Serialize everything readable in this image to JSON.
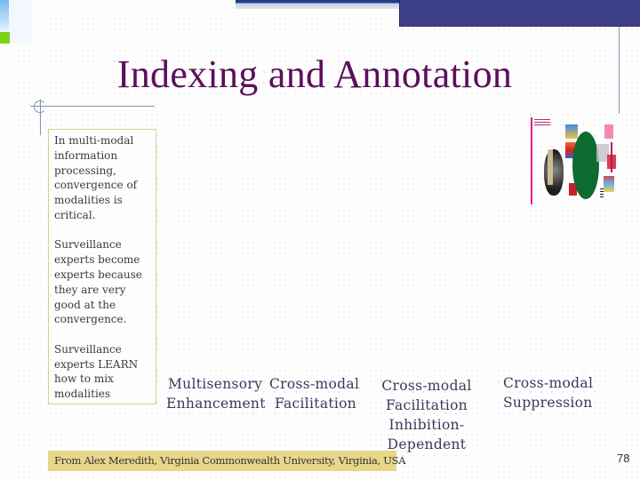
{
  "slide": {
    "title": "Indexing and Annotation",
    "sidebar_paragraphs": [
      "In multi-modal information processing, convergence of modalities is critical.",
      "Surveillance experts become experts because they are very good at the convergence.",
      "Surveillance experts LEARN how to mix modalities"
    ],
    "figure_caption_icon": "brain-multisensory-diagram",
    "labels": [
      {
        "lines": [
          "Multisensory",
          "Enhancement"
        ]
      },
      {
        "lines": [
          "Cross-modal",
          "Facilitation"
        ]
      },
      {
        "lines": [
          "Cross-modal",
          "Facilitation",
          "Inhibition-",
          "Dependent"
        ]
      },
      {
        "lines": [
          "Cross-modal",
          "Suppression"
        ]
      }
    ],
    "credit": "From Alex Meredith, Virginia Commonwealth University, Virginia, USA",
    "slide_number": "78"
  },
  "colors": {
    "title": "#5c0f5c",
    "top_bar": "#3d3f86",
    "credit_bg": "#e8d68a",
    "label_text": "#383a5c",
    "accent_green": "#7ad21a"
  }
}
